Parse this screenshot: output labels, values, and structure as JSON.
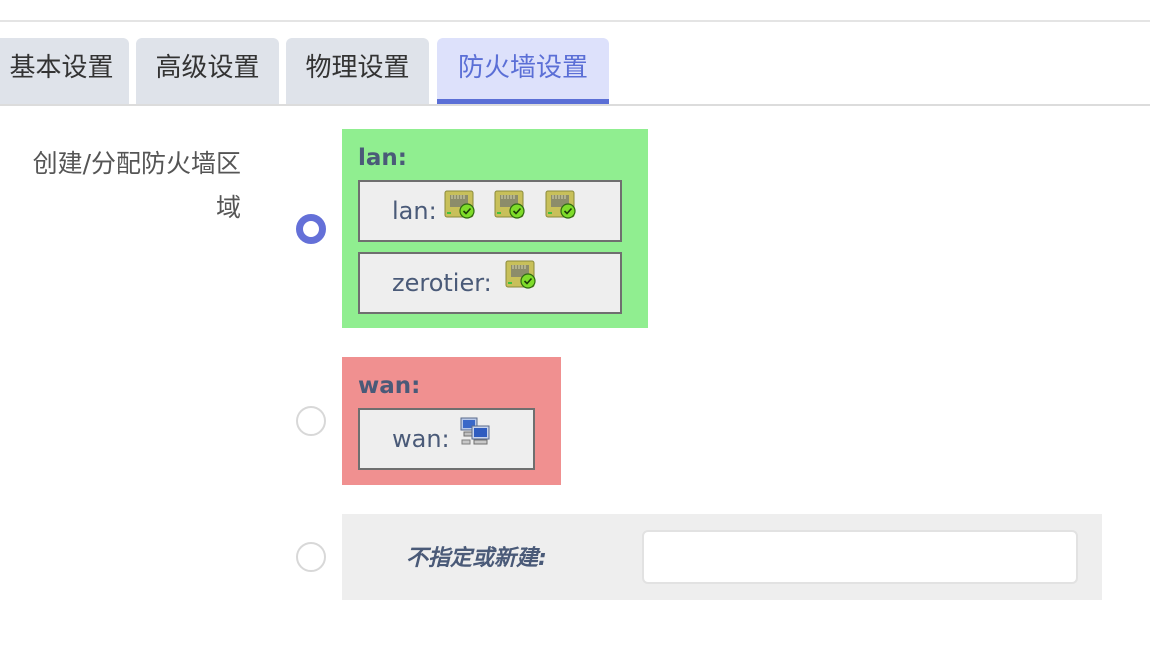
{
  "tabs": [
    {
      "label": "基本设置",
      "active": false
    },
    {
      "label": "高级设置",
      "active": false
    },
    {
      "label": "物理设置",
      "active": false
    },
    {
      "label": "防火墙设置",
      "active": true
    }
  ],
  "field": {
    "label_line1": "创建/分配防火墙区",
    "label_line2": "域"
  },
  "zones": [
    {
      "name": "lan:",
      "color": "#90ee90",
      "selected": true,
      "interfaces": [
        {
          "name": "lan:",
          "icons": [
            "ethernet-port-connected-icon",
            "ethernet-port-connected-icon",
            "ethernet-port-connected-icon"
          ]
        },
        {
          "name": "zerotier:",
          "icons": [
            "ethernet-port-connected-icon"
          ]
        }
      ]
    },
    {
      "name": "wan:",
      "color": "#f09090",
      "selected": false,
      "interfaces": [
        {
          "name": "wan:",
          "icons": [
            "network-computers-icon"
          ]
        }
      ]
    }
  ],
  "unspecified": {
    "label": "不指定或新建:",
    "value": "",
    "placeholder": ""
  },
  "colors": {
    "accent": "#5b6fd6",
    "radio_checked": "#6470d8",
    "tab_bg": "#dfe3ea",
    "tab_active_bg": "#dde1fb"
  }
}
